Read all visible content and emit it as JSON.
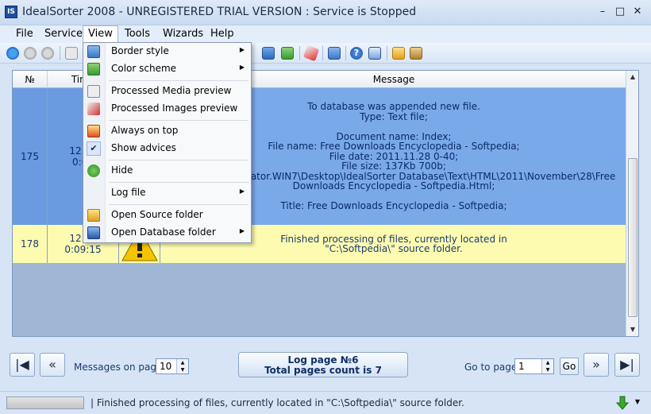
{
  "window": {
    "title": "IdealSorter 2008 - UNREGISTERED TRIAL VERSION : Service is Stopped",
    "minimize": "–",
    "restore": "□",
    "close": "✕"
  },
  "menubar": {
    "items": [
      "File",
      "Service",
      "View",
      "Tools",
      "Wizards",
      "Help"
    ],
    "active": "View"
  },
  "grid": {
    "columns": [
      "№",
      "Time",
      "",
      "Message"
    ],
    "rows": [
      {
        "num": "175",
        "time": "12.01\n0:09",
        "message": [
          "To database was appended new file.",
          "Type: Text file;",
          "",
          "Document name:  Index;",
          "File name:  Free Downloads Encyclopedia - Softpedia;",
          "File date:  2011.11.28 0-40;",
          "File size:  137Kb 700b;",
          "\\Users\\Administrator.WIN7\\Desktop\\IdealSorter Database\\Text\\HTML\\2011\\November\\28\\Free",
          "Downloads Encyclopedia - Softpedia.Html;",
          "",
          "Title:  Free Downloads Encyclopedia - Softpedia;"
        ]
      },
      {
        "num": "178",
        "time": "12.01\n0:09:15",
        "message": [
          "Finished processing of files, currently located in",
          "\"C:\\Softpedia\\\" source folder."
        ]
      }
    ]
  },
  "pager": {
    "first": "⏮",
    "prev": "«",
    "next": "»",
    "last": "⏭",
    "messages_label": "Messages on page:",
    "messages_value": "10",
    "log_page": "Log page №6",
    "total_pages": "Total pages count is 7",
    "goto_label": "Go to page:",
    "goto_value": "1",
    "go_button": "Go"
  },
  "statusbar": {
    "text": "| Finished processing of files, currently located in  \"C:\\Softpedia\\\" source folder."
  },
  "view_menu": {
    "items": [
      {
        "label": "Border style",
        "submenu": true,
        "icon": "border-style-icon"
      },
      {
        "label": "Color scheme",
        "submenu": true,
        "icon": "color-scheme-icon"
      },
      {
        "label": "Processed Media preview",
        "submenu": false,
        "icon": "media-preview-icon"
      },
      {
        "label": "Processed Images preview",
        "submenu": false,
        "icon": "images-preview-icon"
      },
      {
        "label": "Always on top",
        "submenu": false,
        "icon": "always-on-top-icon"
      },
      {
        "label": "Show advices",
        "submenu": false,
        "icon": "check-icon",
        "checked": true
      },
      {
        "label": "Hide",
        "submenu": false,
        "icon": "hide-icon"
      },
      {
        "label": "Log file",
        "submenu": true,
        "icon": ""
      },
      {
        "label": "Open Source folder",
        "submenu": false,
        "icon": "source-folder-icon"
      },
      {
        "label": "Open Database folder",
        "submenu": true,
        "icon": "database-folder-icon"
      }
    ],
    "submenu_arrow": "▶"
  },
  "colors": {
    "selected_row": "#7aa9ea",
    "highlight_row": "#fdfbb0",
    "accent": "#1b4f9c"
  }
}
